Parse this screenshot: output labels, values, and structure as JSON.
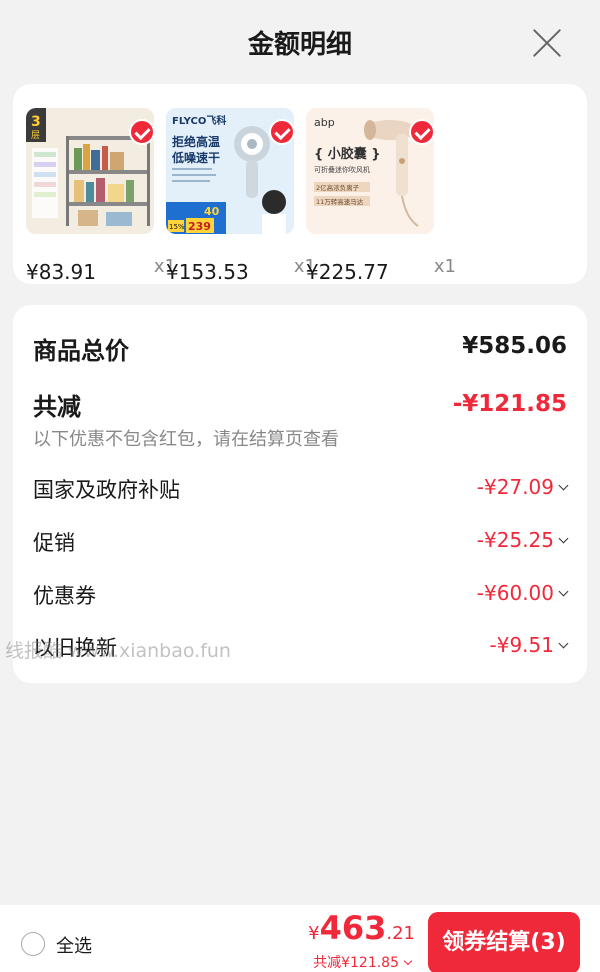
{
  "header": {
    "title": "金额明细"
  },
  "products": [
    {
      "name": "bookshelf",
      "price": "¥83.91",
      "qty": "x1",
      "thumb_text": {
        "badge_top": "3",
        "badge_bottom": "层"
      }
    },
    {
      "name": "flyco-hair-dryer",
      "price": "¥153.53",
      "qty": "x1",
      "thumb_text": {
        "brand": "FLYCO飞科",
        "headline1": "拒绝高温",
        "headline2": "低噪速干",
        "promo_small": "15%",
        "promo_price": "239",
        "promo_tag": "40"
      }
    },
    {
      "name": "abp-hair-dryer",
      "price": "¥225.77",
      "qty": "x1",
      "thumb_text": {
        "brand": "abp",
        "headline": "{ 小胶囊 }",
        "sub1": "可折叠迷你吹风机",
        "sub2": "2亿高浓负离子",
        "sub3": "11万转高速马达"
      }
    }
  ],
  "summary": {
    "total_label": "商品总价",
    "total_value": "¥585.06",
    "discount_label": "共减",
    "discount_value": "-¥121.85",
    "note": "以下优惠不包含红包，请在结算页查看",
    "items": [
      {
        "label": "国家及政府补贴",
        "value": "-¥27.09"
      },
      {
        "label": "促销",
        "value": "-¥25.25"
      },
      {
        "label": "优惠券",
        "value": "-¥60.00"
      },
      {
        "label": "以旧换新",
        "value": "-¥9.51"
      }
    ]
  },
  "watermark": "线报酷 www.xianbao.fun",
  "bottom": {
    "select_all": "全选",
    "currency": "¥",
    "total_int": "463",
    "total_dec": ".21",
    "reduced": "共减¥121.85",
    "checkout": "领券结算(3)"
  },
  "colors": {
    "accent": "#f0293a",
    "background": "#f2f2f2",
    "card": "#ffffff"
  }
}
